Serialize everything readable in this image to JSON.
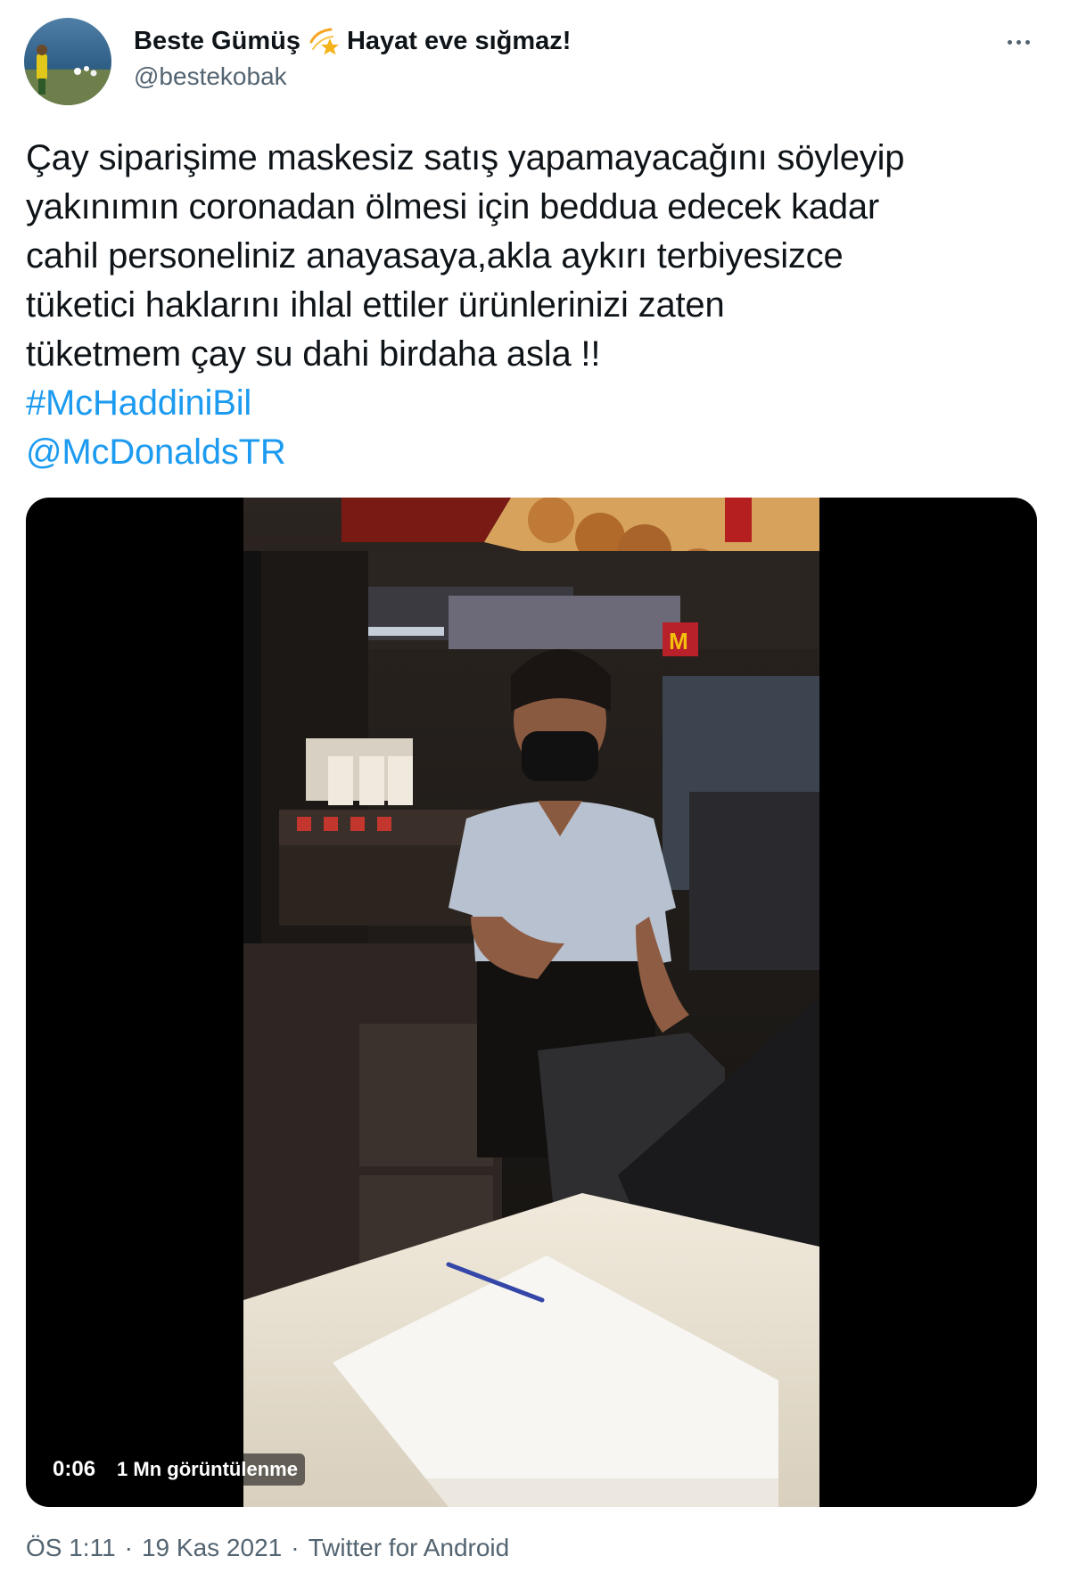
{
  "user": {
    "display_name": "Beste Gümüş",
    "name_emoji": "dizzy-star",
    "bio_suffix": "Hayat eve sığmaz!",
    "handle": "@bestekobak"
  },
  "tweet": {
    "lines": [
      "Çay siparişime maskesiz satış yapamayacağını söyleyip",
      "yakınımın coronadan ölmesi için beddua edecek kadar",
      "cahil personeliniz anayasaya,akla aykırı terbiyesizce",
      "tüketici haklarını ihlal ettiler ürünlerinizi zaten",
      "tüketmem çay su dahi birdaha asla !!"
    ],
    "hashtag": "#McHaddiniBil",
    "mention": "@McDonaldsTR"
  },
  "video": {
    "duration": "0:06",
    "views": "1 Mn görüntülenme"
  },
  "meta": {
    "time": "ÖS 1:11",
    "date": "19 Kas 2021",
    "source": "Twitter for Android",
    "separator": "·"
  },
  "colors": {
    "link": "#1d9bf0",
    "secondary_text": "#536471",
    "primary_text": "#0f1419"
  }
}
